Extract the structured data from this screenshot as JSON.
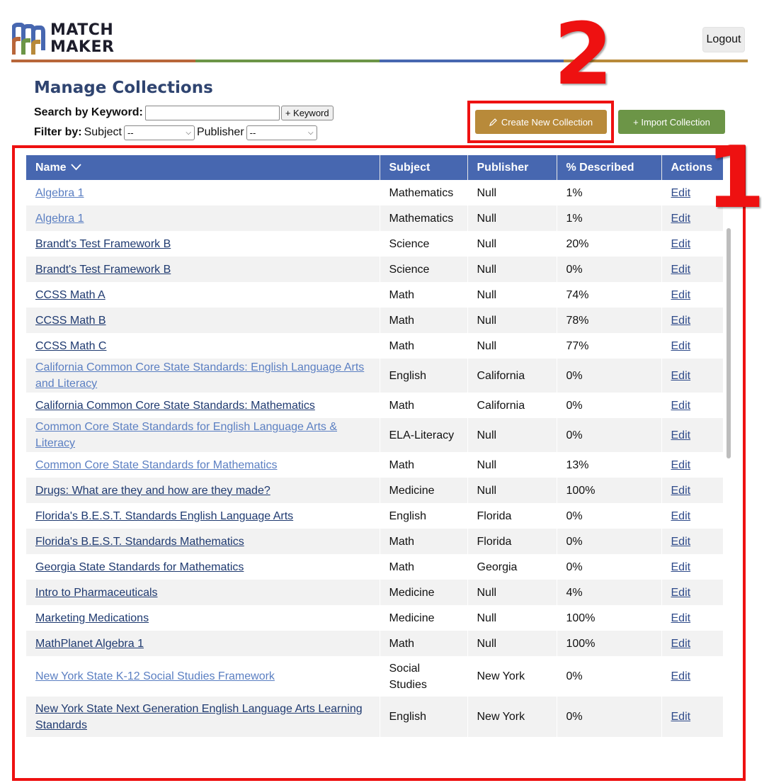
{
  "header": {
    "logo_line1": "MATCH",
    "logo_line2": "MAKER",
    "logout_label": "Logout",
    "rule_colors": [
      "#b8663a",
      "#6c9547",
      "#4767b0",
      "#b88a3a"
    ]
  },
  "page": {
    "title": "Manage Collections",
    "search_label": "Search by Keyword:",
    "search_value": "",
    "keyword_button": "+ Keyword",
    "filter_label": "Filter by:",
    "subject_label": "Subject",
    "subject_selected": "--",
    "publisher_label": "Publisher",
    "publisher_selected": "--"
  },
  "actions": {
    "create_label": "Create New Collection",
    "import_label": "+ Import Collection",
    "create_color": "#b88a3a",
    "import_color": "#6c9547",
    "create_icon": "pencil-icon"
  },
  "annotations": {
    "one": "1",
    "two": "2",
    "color": "#ee1111"
  },
  "table": {
    "columns": [
      "Name",
      "Subject",
      "Publisher",
      "% Described",
      "Actions"
    ],
    "sort_icon": "chevron-down-icon",
    "rows": [
      {
        "name": "Algebra 1",
        "subject": "Mathematics",
        "publisher": "Null",
        "described": "1%",
        "action": "Edit",
        "visited": true
      },
      {
        "name": "Algebra 1",
        "subject": "Mathematics",
        "publisher": "Null",
        "described": "1%",
        "action": "Edit",
        "visited": true
      },
      {
        "name": "Brandt's Test Framework B",
        "subject": "Science",
        "publisher": "Null",
        "described": "20%",
        "action": "Edit",
        "visited": false
      },
      {
        "name": "Brandt's Test Framework B",
        "subject": "Science",
        "publisher": "Null",
        "described": "0%",
        "action": "Edit",
        "visited": false
      },
      {
        "name": "CCSS Math A",
        "subject": "Math",
        "publisher": "Null",
        "described": "74%",
        "action": "Edit",
        "visited": false
      },
      {
        "name": "CCSS Math B",
        "subject": "Math",
        "publisher": "Null",
        "described": "78%",
        "action": "Edit",
        "visited": false
      },
      {
        "name": "CCSS Math C",
        "subject": "Math",
        "publisher": "Null",
        "described": "77%",
        "action": "Edit",
        "visited": false
      },
      {
        "name": "California Common Core State Standards: English Language Arts and Literacy",
        "subject": "English",
        "publisher": "California",
        "described": "0%",
        "action": "Edit",
        "visited": true,
        "tall": true
      },
      {
        "name": "California Common Core State Standards: Mathematics",
        "subject": "Math",
        "publisher": "California",
        "described": "0%",
        "action": "Edit",
        "visited": false
      },
      {
        "name": "Common Core State Standards for English Language Arts & Literacy",
        "subject": "ELA-Literacy",
        "publisher": "Null",
        "described": "0%",
        "action": "Edit",
        "visited": true,
        "tall": true
      },
      {
        "name": "Common Core State Standards for Mathematics",
        "subject": "Math",
        "publisher": "Null",
        "described": "13%",
        "action": "Edit",
        "visited": true
      },
      {
        "name": "Drugs: What are they and how are they made?",
        "subject": "Medicine",
        "publisher": "Null",
        "described": "100%",
        "action": "Edit",
        "visited": false
      },
      {
        "name": "Florida's B.E.S.T. Standards English Language Arts",
        "subject": "English",
        "publisher": "Florida",
        "described": "0%",
        "action": "Edit",
        "visited": false
      },
      {
        "name": "Florida's B.E.S.T. Standards Mathematics",
        "subject": "Math",
        "publisher": "Florida",
        "described": "0%",
        "action": "Edit",
        "visited": false
      },
      {
        "name": "Georgia State Standards for Mathematics",
        "subject": "Math",
        "publisher": "Georgia",
        "described": "0%",
        "action": "Edit",
        "visited": false
      },
      {
        "name": "Intro to Pharmaceuticals",
        "subject": "Medicine",
        "publisher": "Null",
        "described": "4%",
        "action": "Edit",
        "visited": false
      },
      {
        "name": "Marketing Medications",
        "subject": "Medicine",
        "publisher": "Null",
        "described": "100%",
        "action": "Edit",
        "visited": false
      },
      {
        "name": "MathPlanet Algebra 1",
        "subject": "Math",
        "publisher": "Null",
        "described": "100%",
        "action": "Edit",
        "visited": false
      },
      {
        "name": "New York State K-12 Social Studies Framework",
        "subject": "Social Studies",
        "publisher": "New York",
        "described": "0%",
        "action": "Edit",
        "visited": true,
        "tall": true
      },
      {
        "name": "New York State Next Generation English Language Arts Learning Standards",
        "subject": "English",
        "publisher": "New York",
        "described": "0%",
        "action": "Edit",
        "visited": false,
        "tall": true
      }
    ]
  }
}
